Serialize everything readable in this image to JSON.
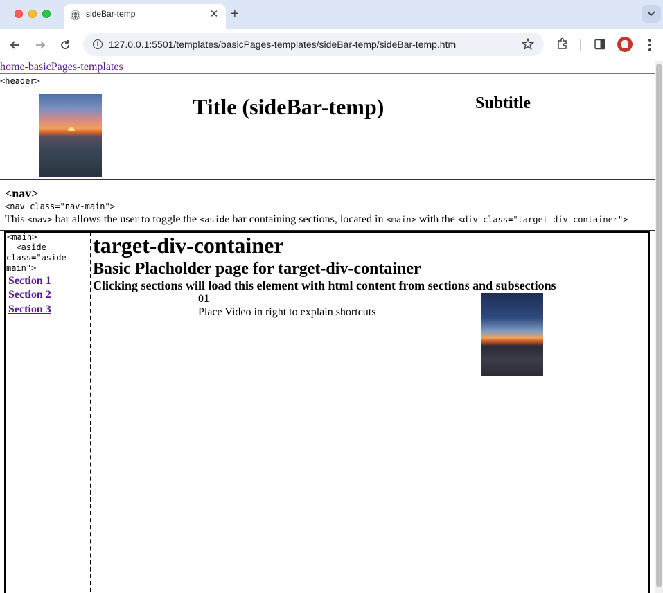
{
  "browser": {
    "tab_title": "sideBar-temp",
    "tab_close": "✕",
    "new_tab": "+",
    "url": "127.0.0.1:5501/templates/basicPages-templates/sideBar-temp/sideBar-temp.htm"
  },
  "page": {
    "home_link": "home-basicPages-templates",
    "header_tag": "<header>",
    "title": "Title (sideBar-temp)",
    "subtitle": "Subtitle",
    "nav": {
      "heading": "<nav>",
      "code": "<nav class=\"nav-main\">",
      "desc_1": "This ",
      "desc_code_1": "<nav>",
      "desc_2": " bar allows the user to toggle the ",
      "desc_code_2": "<aside",
      "desc_3": " bar containing sections, located in ",
      "desc_code_3": "<main>",
      "desc_4": " with the ",
      "desc_code_4": "<div class=\"target-div-container\">"
    },
    "main_tag": "<main>",
    "aside_tag": "  <aside class=\"aside-main\">",
    "sections": [
      "Section 1",
      "Section 2",
      "Section 3"
    ],
    "target": {
      "h1": "target-div-container",
      "h2": "Basic Placholder page for target-div-container",
      "h3": "Clicking sections will load this element with html content from sections and subsections",
      "number": "01",
      "video_text": "Place Video in right to explain shortcuts"
    }
  }
}
